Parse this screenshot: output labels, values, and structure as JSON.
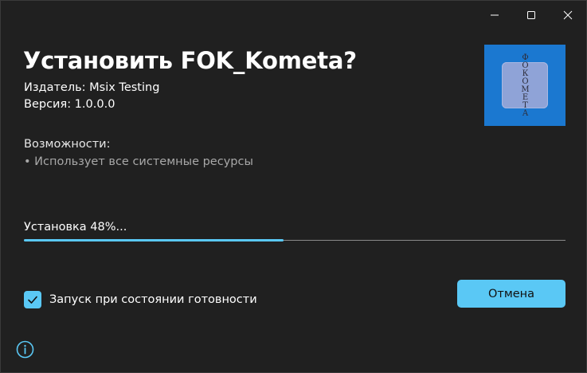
{
  "window": {
    "controls": {
      "minimize_icon": "minimize-icon",
      "maximize_icon": "maximize-icon",
      "close_icon": "close-icon"
    }
  },
  "installer": {
    "title": "Установить FOK_Kometa?",
    "publisher": "Издатель: Msix Testing",
    "version": "Версия: 1.0.0.0",
    "capabilities_heading": "Возможности:",
    "capabilities": [
      "• Использует все системные ресурсы"
    ],
    "app_logo_text": "ФОКОМЕТА",
    "progress": {
      "label": "Установка 48%...",
      "percent": 48
    },
    "launch_when_ready": {
      "label": "Запуск при состоянии готовности",
      "checked": true
    },
    "cancel_label": "Отмена",
    "info_icon": "info-icon"
  },
  "colors": {
    "background": "#202020",
    "accent": "#5ac8f5",
    "tile": "#1b78d0",
    "secondary_text": "#a8a8a8"
  }
}
